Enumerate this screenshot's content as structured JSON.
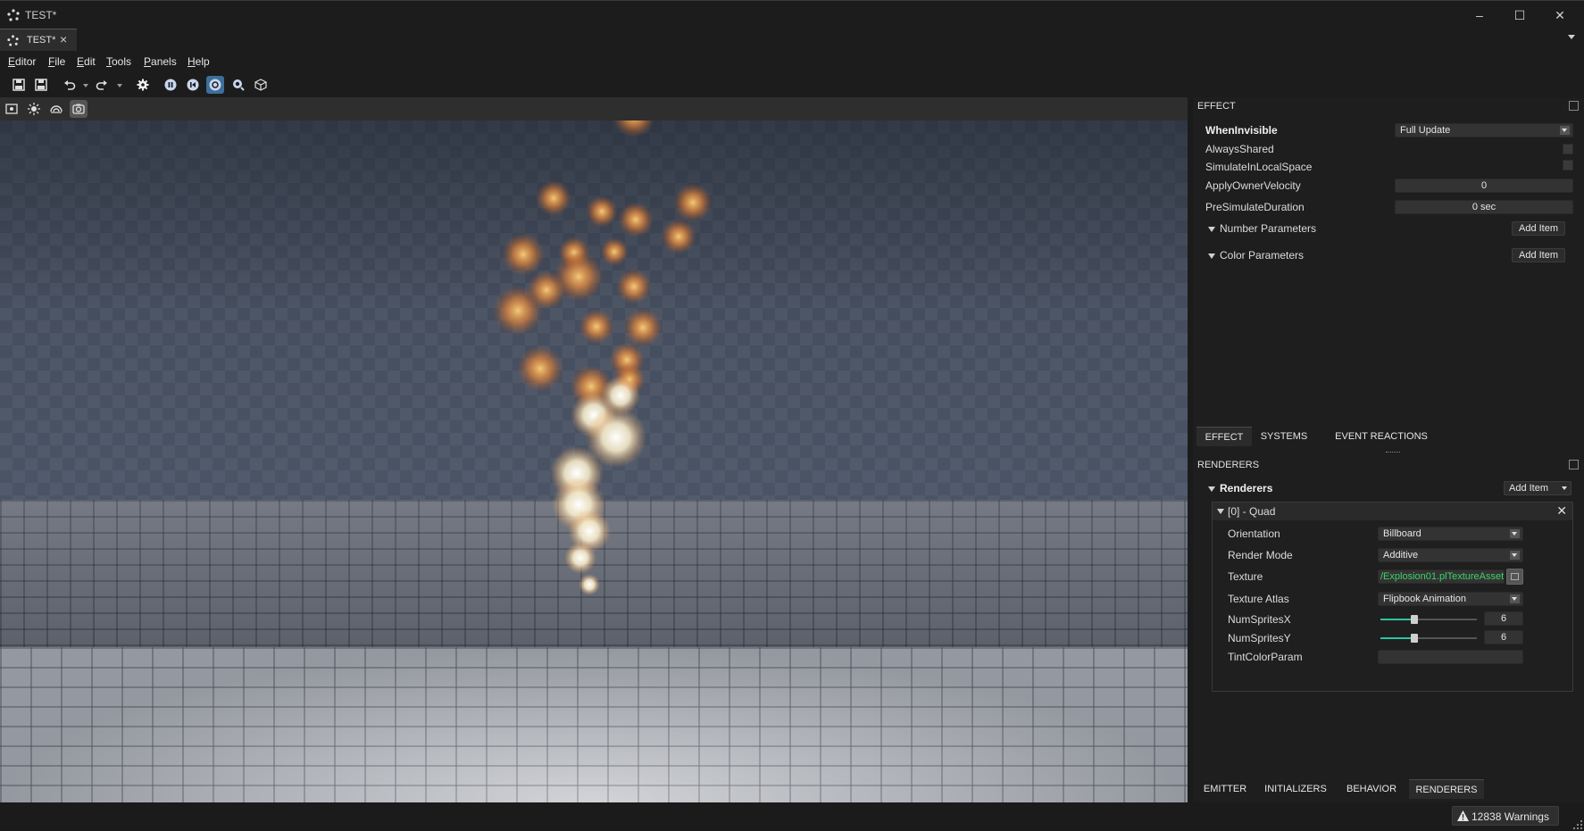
{
  "window": {
    "title": "TEST*"
  },
  "document_tab": {
    "label": "TEST*"
  },
  "menu": [
    {
      "u": "E",
      "rest": "ditor"
    },
    {
      "u": "F",
      "rest": "ile"
    },
    {
      "u": "E",
      "rest": "dit"
    },
    {
      "u": "T",
      "rest": "ools"
    },
    {
      "u": "P",
      "rest": "anels"
    },
    {
      "u": "H",
      "rest": "elp"
    }
  ],
  "effect_panel": {
    "title": "EFFECT",
    "properties": {
      "when_invisible": {
        "label": "WhenInvisible",
        "value": "Full Update"
      },
      "always_shared": {
        "label": "AlwaysShared"
      },
      "simulate_local": {
        "label": "SimulateInLocalSpace"
      },
      "apply_owner_velocity": {
        "label": "ApplyOwnerVelocity",
        "value": "0"
      },
      "presimulate_duration": {
        "label": "PreSimulateDuration",
        "value": "0 sec"
      }
    },
    "number_parameters": {
      "label": "Number Parameters",
      "button": "Add Item"
    },
    "color_parameters": {
      "label": "Color Parameters",
      "button": "Add Item"
    },
    "tabs": [
      "EFFECT",
      "SYSTEMS",
      "EVENT REACTIONS"
    ]
  },
  "renderers_panel": {
    "title": "RENDERERS",
    "group_label": "Renderers",
    "add_button": "Add Item",
    "item_title": "[0] - Quad",
    "orientation": {
      "label": "Orientation",
      "value": "Billboard"
    },
    "render_mode": {
      "label": "Render Mode",
      "value": "Additive"
    },
    "texture": {
      "label": "Texture",
      "value": "/Explosion01.plTextureAsset"
    },
    "texture_atlas": {
      "label": "Texture Atlas",
      "value": "Flipbook Animation"
    },
    "num_sprites_x": {
      "label": "NumSpritesX",
      "value": "6",
      "level": 0.35
    },
    "num_sprites_y": {
      "label": "NumSpritesY",
      "value": "6",
      "level": 0.35
    },
    "tint_color_param": {
      "label": "TintColorParam",
      "value": ""
    },
    "tabs": [
      "EMITTER",
      "INITIALIZERS",
      "BEHAVIOR",
      "RENDERERS"
    ]
  },
  "status": {
    "warnings": "12838 Warnings"
  },
  "colors": {
    "accent": "#2bc4a0",
    "texture_text": "#3cd26a",
    "active_tool": "#3d6f9a"
  }
}
